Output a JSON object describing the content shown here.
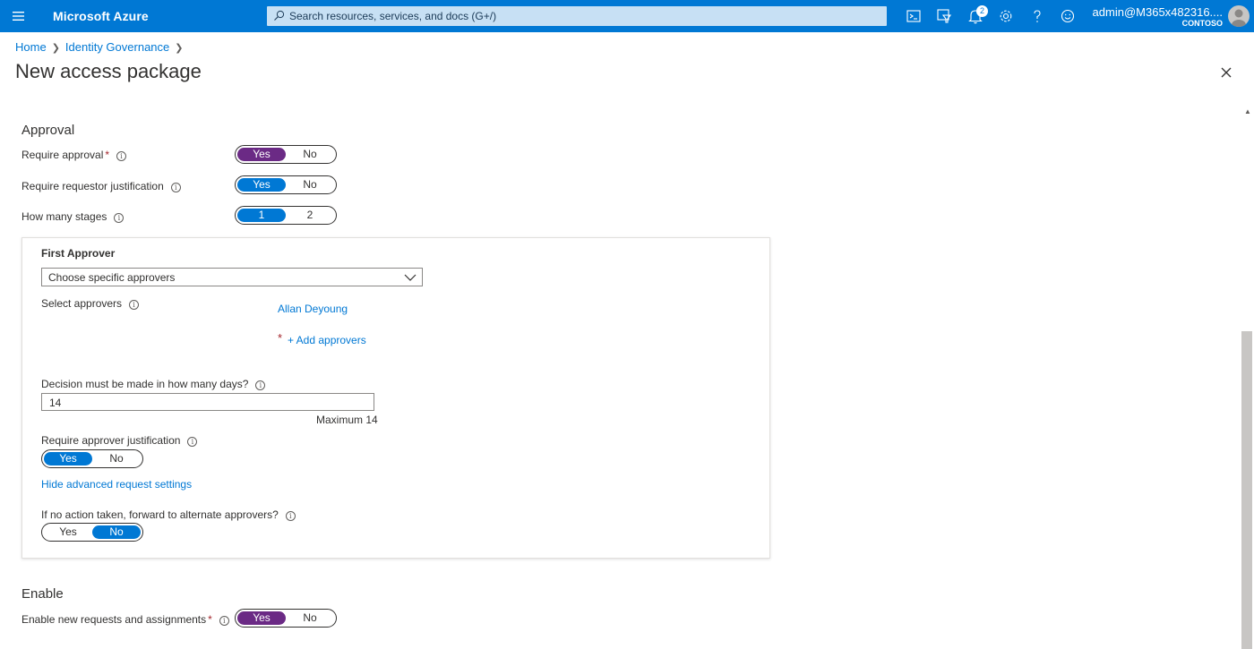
{
  "topbar": {
    "brand": "Microsoft Azure",
    "search_placeholder": "Search resources, services, and docs (G+/)",
    "notification_count": "2",
    "account_email": "admin@M365x482316....",
    "account_tenant": "CONTOSO",
    "icons": [
      "menu-icon",
      "cloud-shell-icon",
      "directory-filter-icon",
      "notifications-icon",
      "settings-icon",
      "help-icon",
      "feedback-icon"
    ]
  },
  "breadcrumb": {
    "home": "Home",
    "identity_governance": "Identity Governance"
  },
  "page": {
    "title": "New access package"
  },
  "approval": {
    "heading": "Approval",
    "require_approval": {
      "label": "Require approval",
      "yes": "Yes",
      "no": "No",
      "selected": "Yes"
    },
    "require_justification": {
      "label": "Require requestor justification",
      "yes": "Yes",
      "no": "No",
      "selected": "Yes"
    },
    "stages": {
      "label": "How many stages",
      "opt1": "1",
      "opt2": "2",
      "selected": "1"
    }
  },
  "first_approver": {
    "title": "First Approver",
    "dropdown_value": "Choose specific approvers",
    "select_label": "Select approvers",
    "approver_name": "Allan Deyoung",
    "add_approvers": "+ Add approvers",
    "decision_label": "Decision must be made in how many days?",
    "decision_value": "14",
    "decision_hint": "Maximum 14",
    "approver_justification": {
      "label": "Require approver justification",
      "yes": "Yes",
      "no": "No",
      "selected": "Yes"
    },
    "hide_advanced": "Hide advanced request settings",
    "forward": {
      "label": "If no action taken, forward to alternate approvers?",
      "yes": "Yes",
      "no": "No",
      "selected": "No"
    }
  },
  "enable": {
    "heading": "Enable",
    "enable_requests": {
      "label": "Enable new requests and assignments",
      "yes": "Yes",
      "no": "No",
      "selected": "Yes"
    }
  },
  "colors": {
    "azure_blue": "#0078d4",
    "toggle_purple": "#6b2a85",
    "required_red": "#a4262c"
  }
}
